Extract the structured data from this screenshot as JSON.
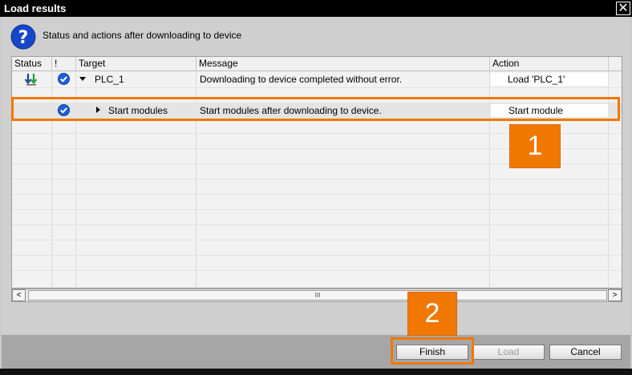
{
  "window": {
    "title": "Load results",
    "close_glyph": "✕"
  },
  "header": {
    "icon": "question-icon",
    "text": "Status and actions after downloading to device"
  },
  "table": {
    "columns": [
      "Status",
      "!",
      "Target",
      "Message",
      "Action"
    ],
    "rows": [
      {
        "status_icon": "download-status-icon",
        "check_icon": "check-circle-icon",
        "expander": "expanded",
        "target": "PLC_1",
        "message": "Downloading to device completed without error.",
        "action": "Load 'PLC_1'"
      },
      {
        "status_icon": "",
        "check_icon": "check-circle-icon",
        "expander": "collapsed",
        "target": "Start modules",
        "message": "Start modules after downloading to device.",
        "action": "Start module"
      }
    ]
  },
  "scrollbar": {
    "left_glyph": "<",
    "right_glyph": ">",
    "thumb_grip": "III"
  },
  "callouts": {
    "one": "1",
    "two": "2"
  },
  "buttons": {
    "finish": "Finish",
    "load": "Load",
    "cancel": "Cancel"
  },
  "colors": {
    "accent": "#f07800",
    "check": "#1e5fd8"
  }
}
